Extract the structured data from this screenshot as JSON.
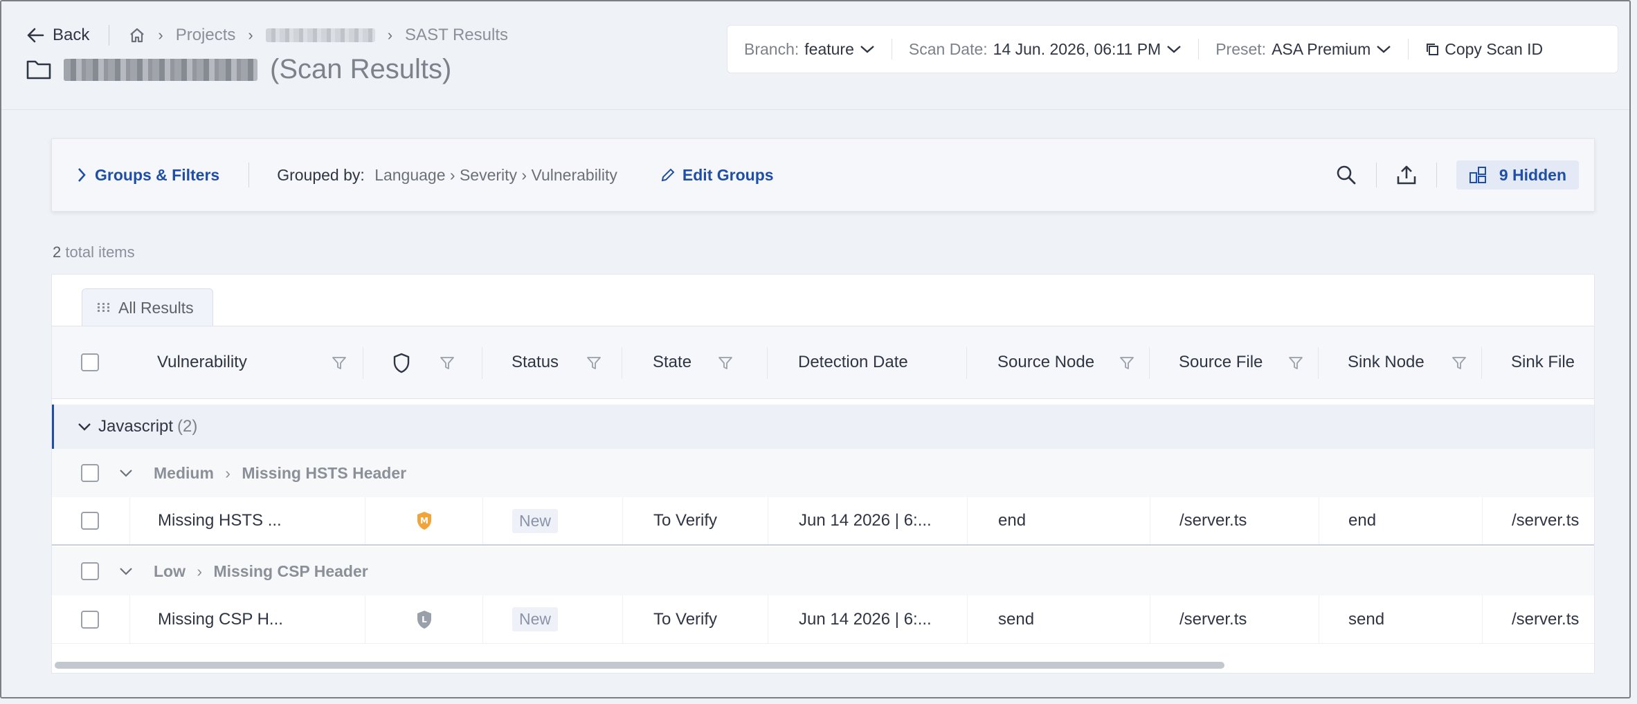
{
  "nav": {
    "back_label": "Back",
    "crumb_projects": "Projects",
    "crumb_current": "SAST Results",
    "title_suffix": "(Scan Results)"
  },
  "scan": {
    "branch_label": "Branch:",
    "branch_value": "feature",
    "date_label": "Scan Date:",
    "date_value": "14 Jun. 2026, 06:11 PM",
    "preset_label": "Preset:",
    "preset_value": "ASA Premium",
    "copy_label": "Copy Scan ID"
  },
  "toolbar": {
    "groups_filters": "Groups & Filters",
    "grouped_by_label": "Grouped by:",
    "grouped_by_path": "Language › Severity › Vulnerability",
    "edit_groups": "Edit Groups",
    "hidden_label": "9 Hidden"
  },
  "summary": {
    "count": "2",
    "label": "total items"
  },
  "tab": {
    "label": "All Results"
  },
  "columns": [
    "Vulnerability",
    "Status",
    "State",
    "Detection Date",
    "Source Node",
    "Source File",
    "Sink Node",
    "Sink File"
  ],
  "groups": {
    "language": {
      "name": "Javascript",
      "count": "(2)"
    },
    "sub1": {
      "severity": "Medium",
      "sep": "›",
      "vuln": "Missing HSTS Header"
    },
    "sub2": {
      "severity": "Low",
      "sep": "›",
      "vuln": "Missing CSP Header"
    }
  },
  "rows": [
    {
      "vulnerability": "Missing HSTS ...",
      "severity_letter": "M",
      "severity_color": "#f0a43a",
      "status": "New",
      "state": "To Verify",
      "date": "Jun 14 2026 | 6:...",
      "source_node": "end",
      "source_file": "/server.ts",
      "sink_node": "end",
      "sink_file": "/server.ts"
    },
    {
      "vulnerability": "Missing CSP H...",
      "severity_letter": "L",
      "severity_color": "#9aa0a9",
      "status": "New",
      "state": "To Verify",
      "date": "Jun 14 2026 | 6:...",
      "source_node": "send",
      "source_file": "/server.ts",
      "sink_node": "send",
      "sink_file": "/server.ts"
    }
  ],
  "colors": {
    "accent": "#1f4ea6",
    "background": "#eff2f7"
  }
}
